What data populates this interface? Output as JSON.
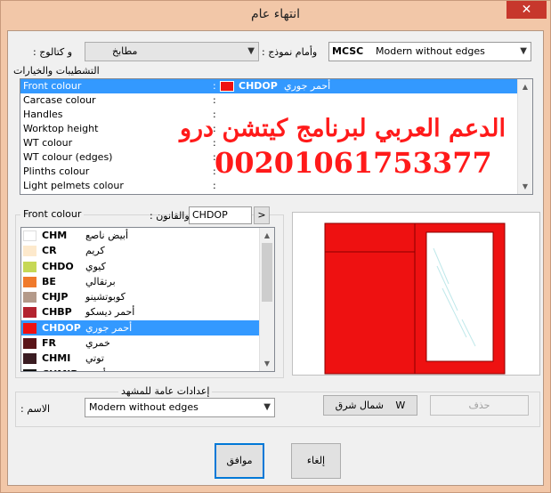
{
  "window": {
    "title": "انتهاء عام",
    "close_glyph": "✕"
  },
  "top": {
    "catalog_label": "و كتالوج :",
    "catalog_value": "مطابخ",
    "model_label": "وأمام نموذج :",
    "model_code": "MCSC",
    "model_value": "Modern without edges",
    "finishes_header": "التشطيبات والخيارات"
  },
  "properties": [
    {
      "label": "Front colour",
      "colon": ":",
      "code": "CHDOP",
      "name": "أحمر جوري",
      "selected": true,
      "swatch": "#ee1111"
    },
    {
      "label": "Carcase colour",
      "colon": ":"
    },
    {
      "label": "Handles",
      "colon": ":"
    },
    {
      "label": "Worktop height",
      "colon": ":"
    },
    {
      "label": "WT colour",
      "colon": ":"
    },
    {
      "label": "WT colour (edges)",
      "colon": ":"
    },
    {
      "label": "Plinths colour",
      "colon": ":"
    },
    {
      "label": "Light pelmets colour",
      "colon": ":"
    }
  ],
  "watermark": {
    "line1": "الدعم العربي لبرنامج كيتشن درو",
    "line2": "00201061753377"
  },
  "colour_panel": {
    "title": "Front colour",
    "code_label": "والقانون :",
    "code_value": "CHDOP",
    "go_label": ">"
  },
  "colours": [
    {
      "code": "CHM",
      "name": "أبيض ناصع",
      "color": "#ffffff"
    },
    {
      "code": "CR",
      "name": "كريم",
      "color": "#fde9cc"
    },
    {
      "code": "CHDO",
      "name": "كيوي",
      "color": "#c6d855"
    },
    {
      "code": "BE",
      "name": "برتقالي",
      "color": "#f07a2c"
    },
    {
      "code": "CHJP",
      "name": "كوبوتشينو",
      "color": "#b49a8a"
    },
    {
      "code": "CHBP",
      "name": "أحمر ديسكو",
      "color": "#b3232f"
    },
    {
      "code": "CHDOP",
      "name": "أحمر جوري",
      "color": "#ee1111",
      "selected": true
    },
    {
      "code": "FR",
      "name": "خمري",
      "color": "#5a1418"
    },
    {
      "code": "CHMI",
      "name": "توتي",
      "color": "#3a1c22"
    },
    {
      "code": "CHMIP",
      "name": "أسود",
      "color": "#111111"
    }
  ],
  "scene": {
    "header": "إعدادات عامة للمشهد",
    "name_label": "الاسم :",
    "name_value": "Modern without edges",
    "north_east_label": "شمال شرق",
    "north_east_key": "W",
    "delete_label": "حذف"
  },
  "buttons": {
    "ok": "موافق",
    "cancel": "إلغاء"
  },
  "colors": {
    "front": "#ee1111",
    "selection": "#3399ff",
    "window_frame": "#f2c7a8"
  }
}
